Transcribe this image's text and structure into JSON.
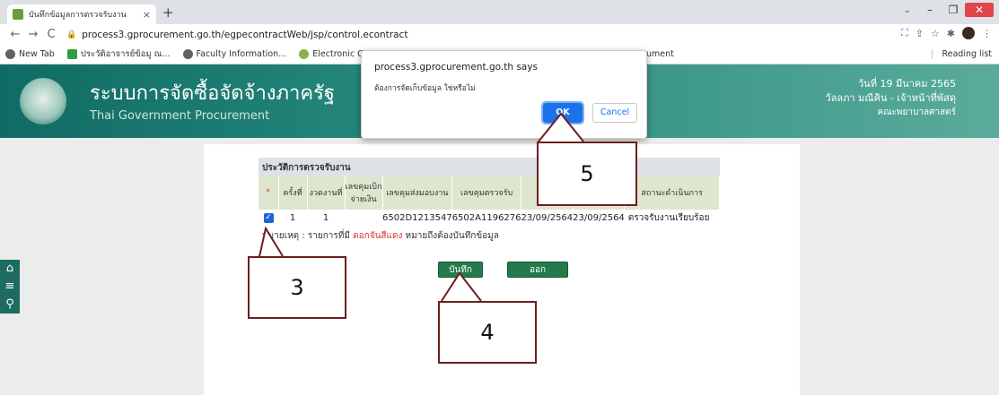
{
  "browser": {
    "tab_title": "บันทึกข้อมูลการตรวจรับงาน",
    "url": "process3.gprocurement.go.th/egpecontractWeb/jsp/control.econtract",
    "bookmarks": [
      "New Tab",
      "ประวัติอาจารย์ข้อมู ณ...",
      "Faculty Information...",
      "Electronic Governm..."
    ],
    "bookmark_trunc": "ument",
    "reading_list": "Reading list"
  },
  "banner": {
    "title_th": "ระบบการจัดซื้อจัดจ้างภาครัฐ",
    "title_en": "Thai Government Procurement",
    "date": "วันที่ 19 มีนาคม 2565",
    "user": "วัลลภา มณีคิน - เจ้าหน้าที่พัสดุ",
    "dept": "คณะพยาบาลศาสตร์"
  },
  "panel": {
    "title": "ประวัติการตรวจรับงาน",
    "columns": [
      "*",
      "ครั้งที่",
      "งวดงานที่",
      "เลขคุมเบิกจ่ายเงิน",
      "เลขคุมส่งมอบงาน",
      "เลขคุมตรวจรับ",
      "",
      "",
      "สถานะดำเนินการ"
    ],
    "row": {
      "round": "1",
      "installment": "1",
      "disbursement_no": "",
      "delivery_no": "6502D1213547",
      "inspection_no": "6502A1196276",
      "date1": "23/09/2564",
      "date2": "23/09/2564",
      "status": "ตรวจรับงานเรียบร้อย"
    },
    "remark_prefix": "หมายเหตุ : รายการที่มี",
    "remark_red": "ดอกจันสีแดง",
    "remark_suffix": "หมายถึงต้องบันทึกข้อมูล"
  },
  "buttons": {
    "save": "บันทึก",
    "exit": "ออก"
  },
  "dialog": {
    "origin": "process3.gprocurement.go.th says",
    "message": "ต้องการจัดเก็บข้อมูล ใช่หรือไม่",
    "ok": "OK",
    "cancel": "Cancel"
  },
  "callouts": {
    "c3": "3",
    "c4": "4",
    "c5": "5"
  }
}
